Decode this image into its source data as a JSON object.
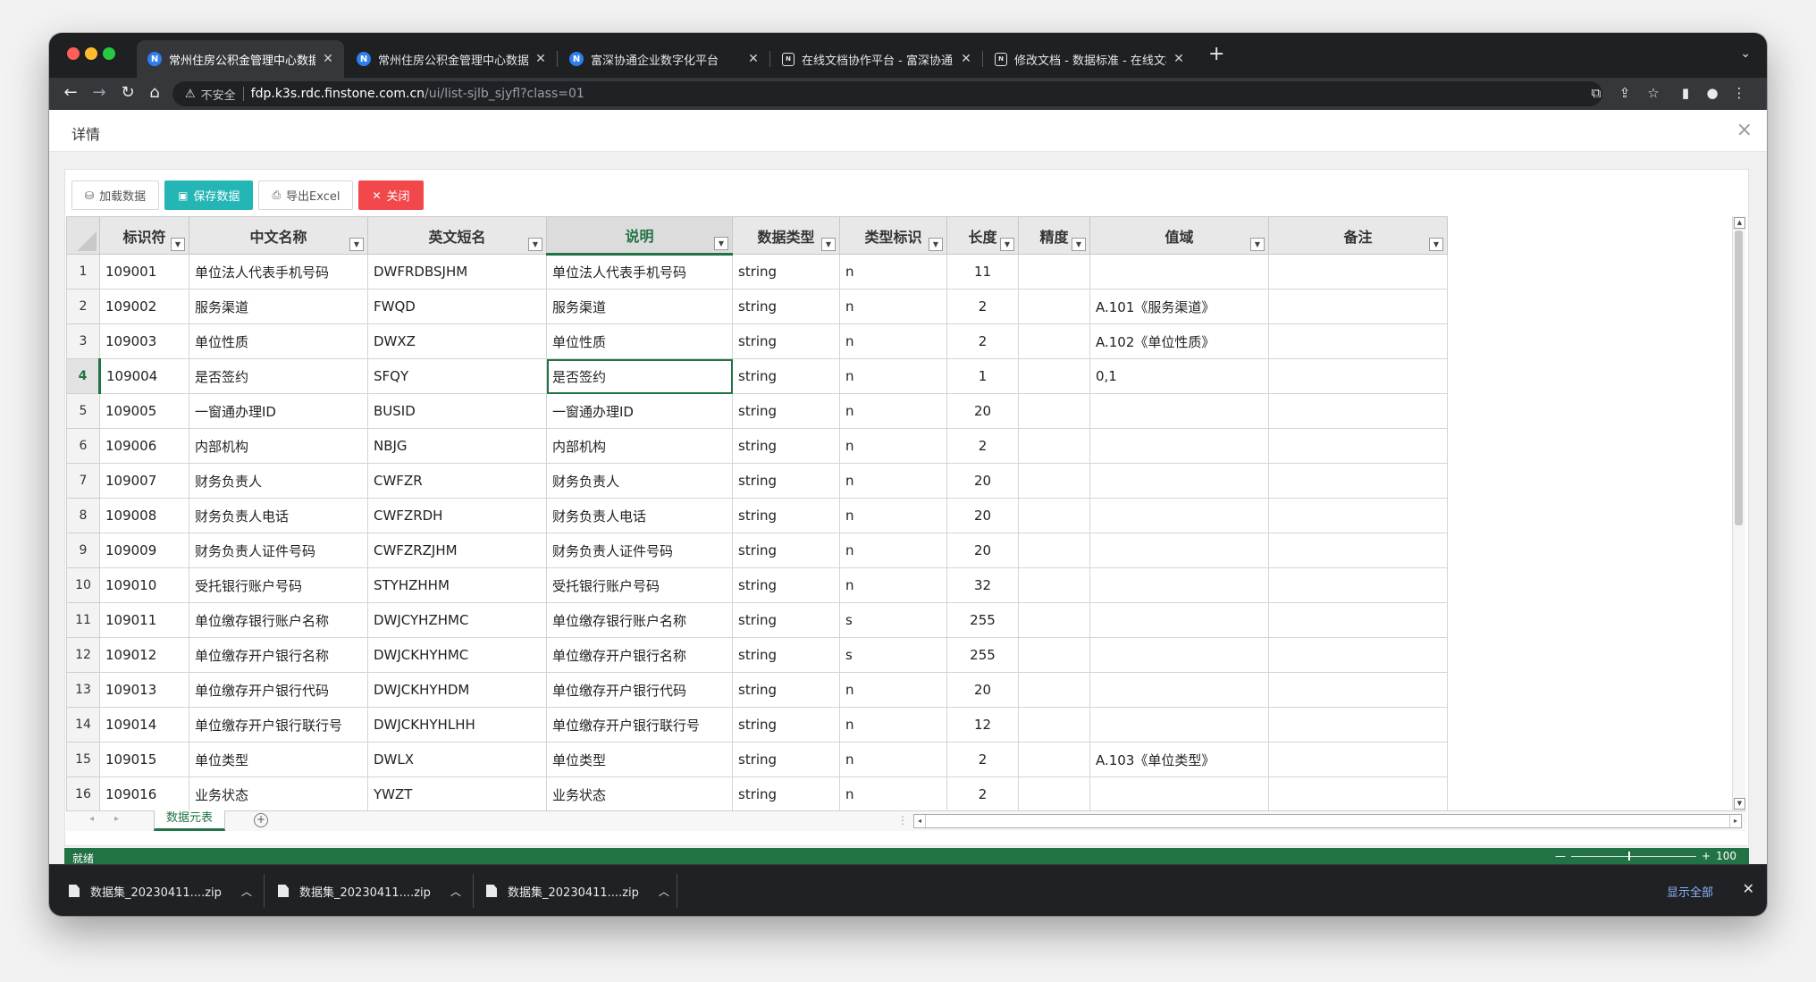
{
  "browser": {
    "tabs": [
      {
        "title": "常州住房公积金管理中心数据管理",
        "icon": "N",
        "active": true
      },
      {
        "title": "常州住房公积金管理中心数据管理",
        "icon": "N",
        "active": false
      },
      {
        "title": "富深协通企业数字化平台",
        "icon": "N",
        "active": false
      },
      {
        "title": "在线文档协作平台 - 富深协通",
        "icon": "doc",
        "active": false
      },
      {
        "title": "修改文档 - 数据标准 - 在线文档协",
        "icon": "doc",
        "active": false
      }
    ],
    "address": {
      "warning": "不安全",
      "host": "fdp.k3s.rdc.finstone.com.cn",
      "path": "/ui/list-sjlb_sjyfl?class=01"
    }
  },
  "dialog": {
    "title": "详情",
    "buttons": {
      "load": "加载数据",
      "save": "保存数据",
      "export": "导出Excel",
      "close": "关闭"
    }
  },
  "grid": {
    "columns": [
      "标识符",
      "中文名称",
      "英文短名",
      "说明",
      "数据类型",
      "类型标识",
      "长度",
      "精度",
      "值域",
      "备注"
    ],
    "selected_column": 3,
    "selected_row": 4,
    "rows": [
      {
        "n": "1",
        "id": "109001",
        "cn": "单位法人代表手机号码",
        "en": "DWFRDBSJHM",
        "desc": "单位法人代表手机号码",
        "type": "string",
        "flag": "n",
        "len": "11",
        "prec": "",
        "domain": "",
        "note": ""
      },
      {
        "n": "2",
        "id": "109002",
        "cn": "服务渠道",
        "en": "FWQD",
        "desc": "服务渠道",
        "type": "string",
        "flag": "n",
        "len": "2",
        "prec": "",
        "domain": "A.101《服务渠道》",
        "note": ""
      },
      {
        "n": "3",
        "id": "109003",
        "cn": "单位性质",
        "en": "DWXZ",
        "desc": "单位性质",
        "type": "string",
        "flag": "n",
        "len": "2",
        "prec": "",
        "domain": "A.102《单位性质》",
        "note": ""
      },
      {
        "n": "4",
        "id": "109004",
        "cn": "是否签约",
        "en": "SFQY",
        "desc": "是否签约",
        "type": "string",
        "flag": "n",
        "len": "1",
        "prec": "",
        "domain": "0,1",
        "note": ""
      },
      {
        "n": "5",
        "id": "109005",
        "cn": "一窗通办理ID",
        "en": "BUSID",
        "desc": "一窗通办理ID",
        "type": "string",
        "flag": "n",
        "len": "20",
        "prec": "",
        "domain": "",
        "note": ""
      },
      {
        "n": "6",
        "id": "109006",
        "cn": "内部机构",
        "en": "NBJG",
        "desc": "内部机构",
        "type": "string",
        "flag": "n",
        "len": "2",
        "prec": "",
        "domain": "",
        "note": ""
      },
      {
        "n": "7",
        "id": "109007",
        "cn": "财务负责人",
        "en": "CWFZR",
        "desc": "财务负责人",
        "type": "string",
        "flag": "n",
        "len": "20",
        "prec": "",
        "domain": "",
        "note": ""
      },
      {
        "n": "8",
        "id": "109008",
        "cn": "财务负责人电话",
        "en": "CWFZRDH",
        "desc": "财务负责人电话",
        "type": "string",
        "flag": "n",
        "len": "20",
        "prec": "",
        "domain": "",
        "note": ""
      },
      {
        "n": "9",
        "id": "109009",
        "cn": "财务负责人证件号码",
        "en": "CWFZRZJHM",
        "desc": "财务负责人证件号码",
        "type": "string",
        "flag": "n",
        "len": "20",
        "prec": "",
        "domain": "",
        "note": ""
      },
      {
        "n": "10",
        "id": "109010",
        "cn": "受托银行账户号码",
        "en": "STYHZHHM",
        "desc": "受托银行账户号码",
        "type": "string",
        "flag": "n",
        "len": "32",
        "prec": "",
        "domain": "",
        "note": ""
      },
      {
        "n": "11",
        "id": "109011",
        "cn": "单位缴存银行账户名称",
        "en": "DWJCYHZHMC",
        "desc": "单位缴存银行账户名称",
        "type": "string",
        "flag": "s",
        "len": "255",
        "prec": "",
        "domain": "",
        "note": ""
      },
      {
        "n": "12",
        "id": "109012",
        "cn": "单位缴存开户银行名称",
        "en": "DWJCKHYHMC",
        "desc": "单位缴存开户银行名称",
        "type": "string",
        "flag": "s",
        "len": "255",
        "prec": "",
        "domain": "",
        "note": ""
      },
      {
        "n": "13",
        "id": "109013",
        "cn": "单位缴存开户银行代码",
        "en": "DWJCKHYHDM",
        "desc": "单位缴存开户银行代码",
        "type": "string",
        "flag": "n",
        "len": "20",
        "prec": "",
        "domain": "",
        "note": ""
      },
      {
        "n": "14",
        "id": "109014",
        "cn": "单位缴存开户银行联行号",
        "en": "DWJCKHYHLHH",
        "desc": "单位缴存开户银行联行号",
        "type": "string",
        "flag": "n",
        "len": "12",
        "prec": "",
        "domain": "",
        "note": ""
      },
      {
        "n": "15",
        "id": "109015",
        "cn": "单位类型",
        "en": "DWLX",
        "desc": "单位类型",
        "type": "string",
        "flag": "n",
        "len": "2",
        "prec": "",
        "domain": "A.103《单位类型》",
        "note": ""
      },
      {
        "n": "16",
        "id": "109016",
        "cn": "业务状态",
        "en": "YWZT",
        "desc": "业务状态",
        "type": "string",
        "flag": "n",
        "len": "2",
        "prec": "",
        "domain": "",
        "note": ""
      }
    ]
  },
  "sheet": {
    "tab": "数据元表"
  },
  "status": {
    "text": "就绪",
    "zoom": "100",
    "zoom_minus": "—",
    "zoom_plus": "+"
  },
  "downloads": {
    "items": [
      "数据集_20230411....zip",
      "数据集_20230411....zip",
      "数据集_20230411....zip"
    ],
    "show_all": "显示全部"
  }
}
